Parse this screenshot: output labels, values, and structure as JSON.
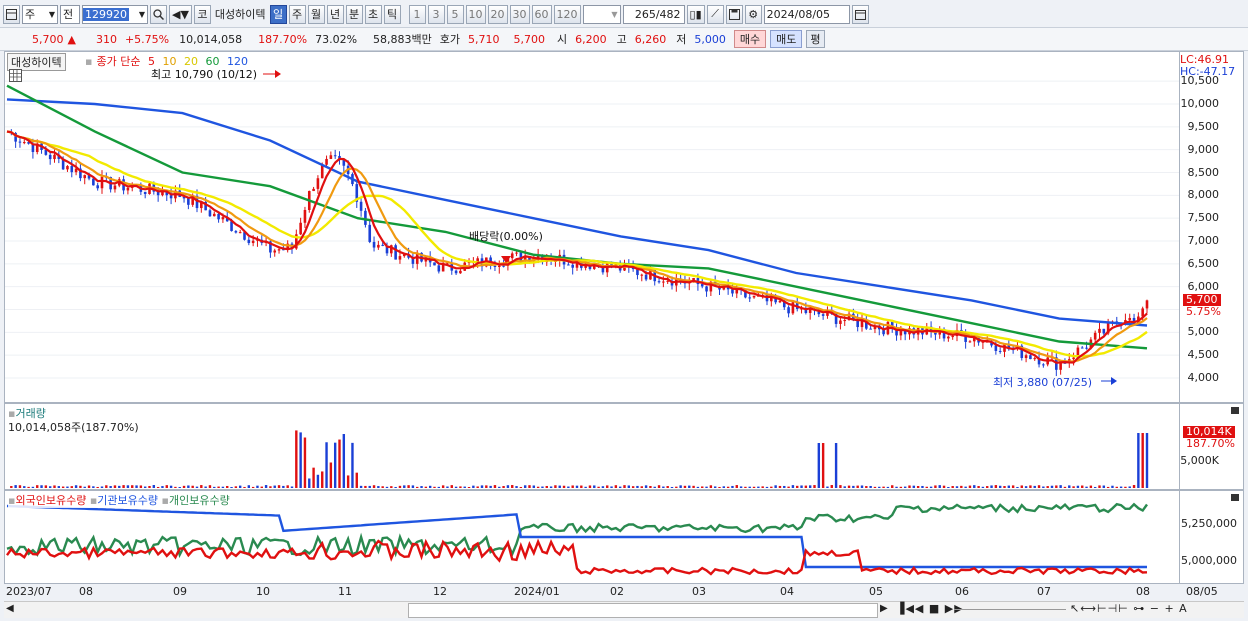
{
  "toolbar": {
    "type_select": "주",
    "prev_label": "전",
    "code": "129920",
    "market_tag": "코",
    "stock_name": "대성하이텍",
    "periods": [
      "일",
      "주",
      "월",
      "년",
      "분",
      "초",
      "틱"
    ],
    "selected_period": "일",
    "intervals": [
      "1",
      "3",
      "5",
      "10",
      "20",
      "30",
      "60",
      "120"
    ],
    "count": "265",
    "total": "/482",
    "date": "2024/08/05"
  },
  "quote": {
    "price": "5,700",
    "change_arrow": "▲",
    "change": "310",
    "change_pct": "+5.75%",
    "volume": "10,014,058",
    "volume_ratio": "187.70%",
    "turnover": "73.02%",
    "amount": "58,883백만",
    "bid_label": "호가",
    "bid": "5,710",
    "ask": "5,700",
    "open_label": "시",
    "open": "6,200",
    "high_label": "고",
    "high": "6,260",
    "low_label": "저",
    "low": "5,000",
    "buy_label": "매수",
    "sell_label": "매도",
    "eval_label": "평"
  },
  "price_panel": {
    "name_tag": "대성하이텍",
    "ma_label": "종가 단순",
    "ma_periods": [
      "5",
      "10",
      "20",
      "60",
      "120"
    ],
    "ma_colors": [
      "#e01010",
      "#e0a000",
      "#f0e000",
      "#10a010",
      "#1050e0"
    ],
    "high_note": "최고 10,790 (10/12)",
    "low_note": "최저 3,880 (07/25)",
    "dividend_note": "배당락(0.00%)",
    "lc": "LC:46.91",
    "hc": "HC:-47.17",
    "y_ticks": [
      "10,500",
      "10,000",
      "9,500",
      "9,000",
      "8,500",
      "8,000",
      "7,500",
      "7,000",
      "6,500",
      "6,000",
      "5,500",
      "5,000",
      "4,500",
      "4,000"
    ],
    "price_tag": "5,700",
    "pct_tag": "5.75%"
  },
  "volume_panel": {
    "title": "거래량",
    "value": "10,014,058주(187.70%)",
    "y_ticks": [
      "5,000K"
    ],
    "tag_value": "10,014K",
    "tag_pct": "187.70%"
  },
  "holding_panel": {
    "legend": [
      "외국인보유수량",
      "기관보유수량",
      "개인보유수량"
    ],
    "legend_colors": [
      "#e01010",
      "#1050e0",
      "#2a8a50"
    ],
    "y_ticks": [
      "5,250,000",
      "5,000,000"
    ]
  },
  "x_axis": [
    "2023/07",
    "08",
    "09",
    "10",
    "11",
    "12",
    "2024/01",
    "02",
    "03",
    "04",
    "05",
    "06",
    "07",
    "08",
    "08/05"
  ],
  "chart_data": {
    "type": "candlestick",
    "ylim": [
      3700,
      10700
    ],
    "x": [
      "2023/07",
      "08",
      "09",
      "10",
      "11",
      "12",
      "2024/01",
      "02",
      "03",
      "04",
      "05",
      "06",
      "07",
      "08"
    ],
    "close_approx": [
      9400,
      8300,
      8000,
      6800,
      7000,
      6400,
      6700,
      6400,
      6000,
      5500,
      5100,
      4900,
      4300,
      5700
    ],
    "ma60_approx": [
      10400,
      9400,
      8500,
      8200,
      7500,
      7200,
      6700,
      6500,
      6400,
      6000,
      5600,
      5200,
      4800,
      4650
    ],
    "ma120_approx": [
      10100,
      10000,
      9800,
      9200,
      8300,
      7900,
      7500,
      7100,
      6800,
      6300,
      6000,
      5700,
      5300,
      5150
    ],
    "annotations": [
      "최고 10,790 (10/12)",
      "최저 3,880 (07/25)",
      "배당락(0.00%)"
    ]
  }
}
